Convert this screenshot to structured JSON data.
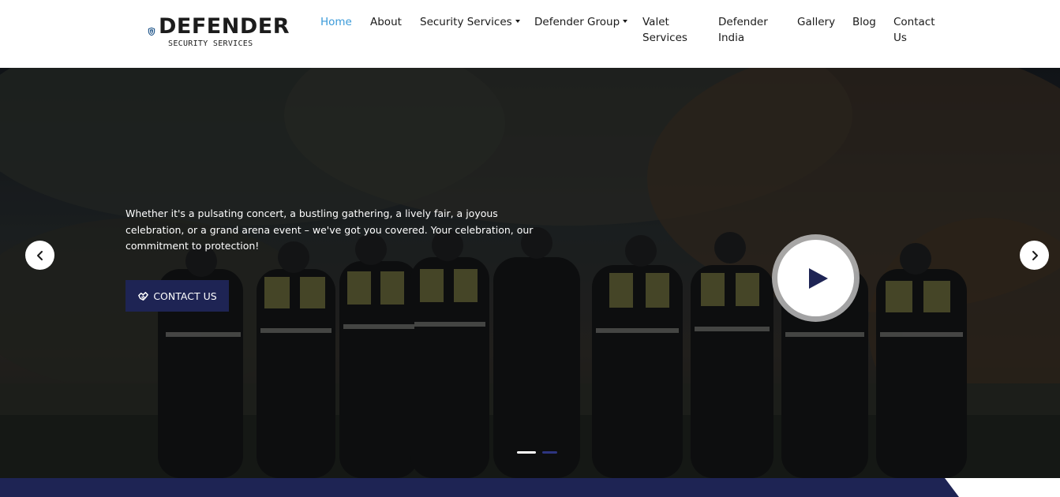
{
  "brand": {
    "name": "DEFENDER",
    "tagline": "SECURITY SERVICES",
    "shield_color": "#2a5d8f"
  },
  "nav": {
    "items": [
      {
        "label": "Home",
        "active": true
      },
      {
        "label": "About"
      },
      {
        "label": "Security Services",
        "dropdown": true
      },
      {
        "label": "Defender Group",
        "dropdown": true
      },
      {
        "label_line1": "Valet",
        "label_line2": "Services"
      },
      {
        "label_line1": "Defender",
        "label_line2": "India"
      },
      {
        "label": "Gallery"
      },
      {
        "label": "Blog"
      },
      {
        "label_line1": "Contact",
        "label_line2": "Us"
      }
    ],
    "active_color": "#3a9ad9"
  },
  "hero": {
    "text": "Whether it's a pulsating concert, a bustling gathering, a lively fair, a joyous celebration, or a grand arena event – we've got you covered. Your celebration, our commitment to protection!",
    "cta_label": "CONTACT US",
    "cta_icon": "handshake-icon",
    "prev_icon": "chevron-left-icon",
    "next_icon": "chevron-right-icon",
    "play_icon": "play-icon",
    "slides_total": 2,
    "slide_active": 1,
    "cta_color": "#1e2454",
    "play_color": "#1e2454"
  },
  "band_color": "#1e2454"
}
